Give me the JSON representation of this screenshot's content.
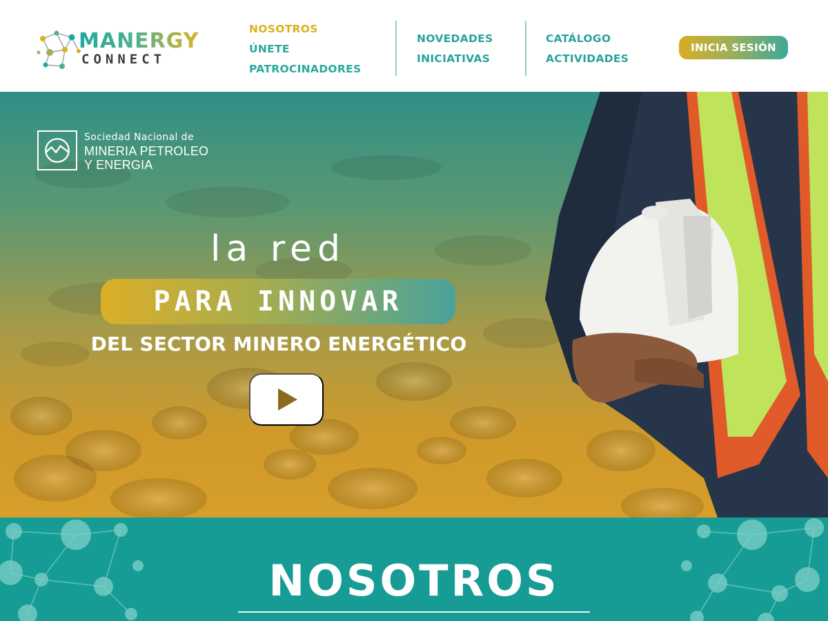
{
  "brand": {
    "name": "MANERGY",
    "tagline": "CONNECT"
  },
  "nav": {
    "group1": [
      "NOSOTROS",
      "ÚNETE",
      "PATROCINADORES"
    ],
    "group2": [
      "NOVEDADES",
      "INICIATIVAS"
    ],
    "group3": [
      "CATÁLOGO",
      "ACTIVIDADES"
    ],
    "active": "NOSOTROS",
    "login_label": "INICIA SESIÓN"
  },
  "hero": {
    "org": {
      "line1": "Sociedad Nacional de",
      "line2": "MINERIA PETROLEO",
      "line3": "Y ENERGIA"
    },
    "headline_top": "la red",
    "headline_pill": "PARA INNOVAR",
    "headline_bottom": "DEL SECTOR MINERO ENERGÉTICO",
    "play_icon": "play-icon"
  },
  "section": {
    "title": "NOSOTROS"
  },
  "colors": {
    "teal": "#169c94",
    "gold": "#d9b21f",
    "nav_teal": "#29a89c"
  }
}
